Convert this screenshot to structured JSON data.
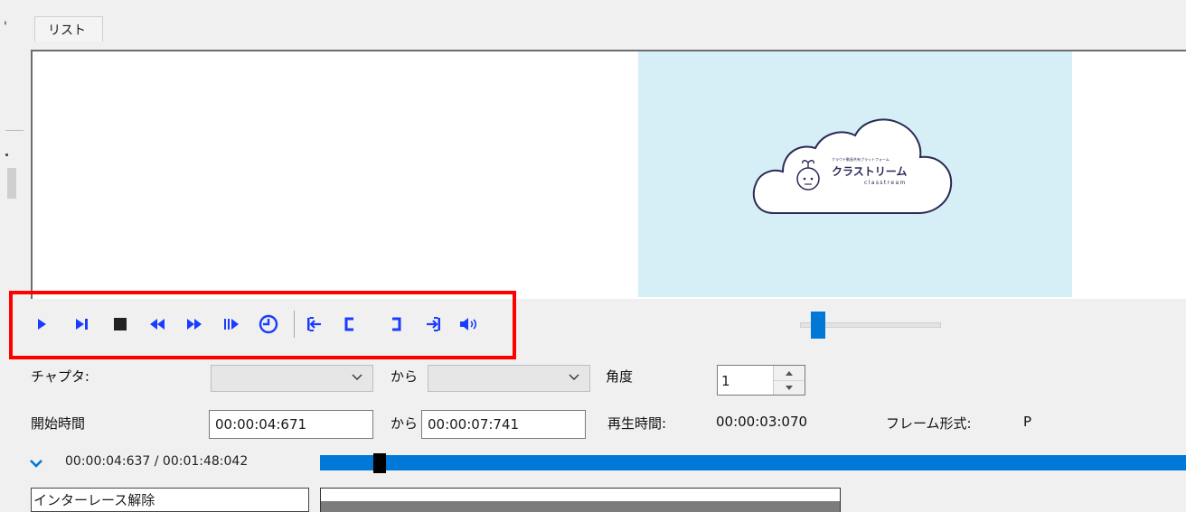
{
  "tabs": {
    "left_fragment": "'",
    "list_tab": "リスト"
  },
  "preview": {
    "logo_small_text": "クラウド動画共有プラットフォーム",
    "logo_title": "クラストリーム",
    "logo_subtitle": "classtream"
  },
  "toolbar": {
    "accent_color": "#1a3cff",
    "highlight_color": "#ff0000",
    "buttons": [
      {
        "name": "play",
        "icon": "play-icon"
      },
      {
        "name": "next-frame",
        "icon": "next-frame-icon"
      },
      {
        "name": "stop",
        "icon": "stop-icon"
      },
      {
        "name": "rewind",
        "icon": "rewind-icon"
      },
      {
        "name": "fast-forward",
        "icon": "fast-forward-icon"
      },
      {
        "name": "frame-forward",
        "icon": "frame-step-icon"
      },
      {
        "name": "time-jump",
        "icon": "clock-icon"
      },
      {
        "name": "go-to-start-point",
        "icon": "go-to-in-icon"
      },
      {
        "name": "set-start-point",
        "icon": "in-bracket-icon"
      },
      {
        "name": "set-end-point",
        "icon": "out-bracket-icon"
      },
      {
        "name": "go-to-end-point",
        "icon": "go-to-out-icon"
      },
      {
        "name": "volume",
        "icon": "volume-icon"
      }
    ]
  },
  "zoom": {
    "level": 0.1
  },
  "form": {
    "chapter_label": "チャプタ:",
    "from_label_1": "から",
    "angle_label": "角度",
    "angle_value": "1",
    "start_time_label": "開始時間",
    "start_time_value": "00:00:04:671",
    "from_label_2": "から",
    "end_time_value": "00:00:07:741",
    "duration_label": "再生時間:",
    "duration_value": "00:00:03:070",
    "frame_format_label": "フレーム形式:",
    "frame_format_value": "P"
  },
  "seek": {
    "current": "00:00:04:637",
    "separator": "/",
    "total": "00:01:48:042",
    "time_display": "00:00:04:637 / 00:01:48:042",
    "position_fraction": 0.043,
    "color": "#0078d7"
  },
  "bottom": {
    "filter_label": "インターレース解除"
  }
}
